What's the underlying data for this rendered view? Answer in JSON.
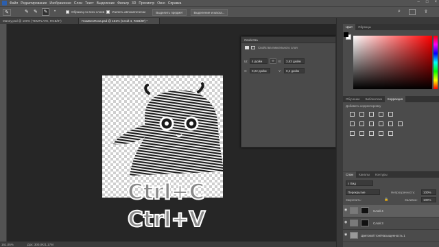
{
  "menu": [
    "Файл",
    "Редактирование",
    "Изображение",
    "Слои",
    "Текст",
    "Выделение",
    "Фильтр",
    "3D",
    "Просмотр",
    "Окно",
    "Справка"
  ],
  "options": {
    "sample_all": "Образец со всех слоев",
    "auto_enhance": "Усилить автоматически",
    "select_subject": "Выделить предмет",
    "select_and_mask": "Выделение и маска..."
  },
  "tabs": [
    {
      "label": "Maney.psd @ 100% (TEMPLATE, RGB/8*)"
    },
    {
      "label": "ГномБезФона.psd @ 161% (Слой 4, RGB/8#) *"
    }
  ],
  "canvas": {
    "line1": "Ctrl+C",
    "line2": "Ctrl+V"
  },
  "properties": {
    "title": "Свойства",
    "subtitle": "Свойства пиксельного слоя",
    "w_label": "Ш:",
    "w_value": "4 дюйм",
    "h_label": "В:",
    "h_value": "3,63 дюйм",
    "x_label": "X:",
    "x_value": "0,22 дюйм",
    "y_label": "Y:",
    "y_value": "0,4 дюйм"
  },
  "color_panel": {
    "tabs": [
      "Цвет",
      "Образцы"
    ]
  },
  "adj_panel": {
    "tabs": [
      "Обучение",
      "Библиотеки",
      "Коррекция"
    ],
    "hint": "Добавить корректировку"
  },
  "layers_panel": {
    "tabs": [
      "Слои",
      "Каналы",
      "Контуры"
    ],
    "filter": "Вид",
    "blend": "Перекрытие",
    "opacity_label": "Непрозрачность:",
    "opacity": "100%",
    "lock_label": "Закрепить:",
    "fill_label": "Заливка:",
    "fill": "100%",
    "layers": [
      {
        "name": "Слой 4"
      },
      {
        "name": "Слой 3"
      },
      {
        "name": "Цветовой тон/Насыщенность 1"
      }
    ]
  },
  "status": {
    "zoom": "161,05%",
    "doc": "Док: 300,0K/1,17M"
  },
  "colors": {
    "accent": "#c11d1d",
    "panel": "#4b4b4b",
    "canvas_bg": "#262626"
  }
}
